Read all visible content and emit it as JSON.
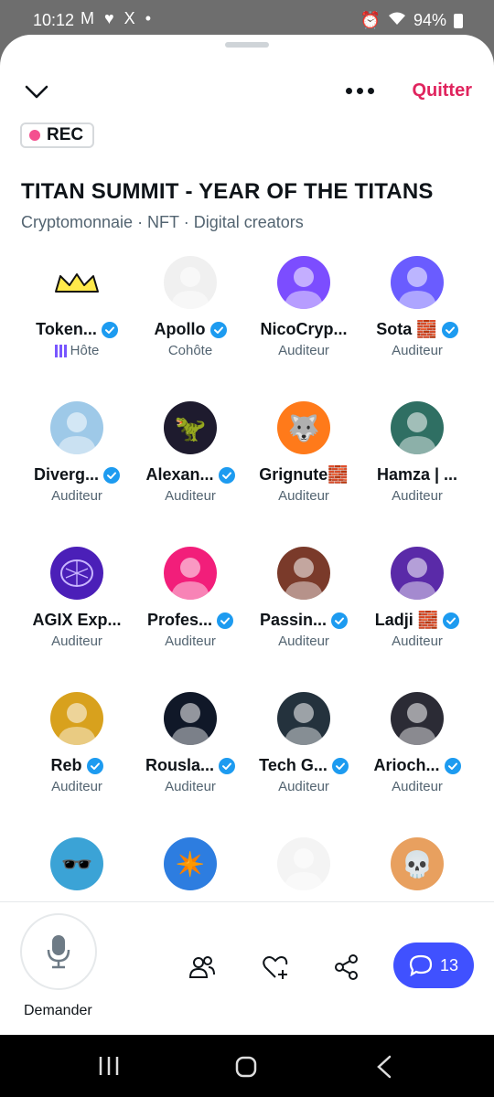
{
  "status": {
    "time": "10:12",
    "notifications": "M ♥ X •",
    "battery": "94%"
  },
  "header": {
    "quit_label": "Quitter"
  },
  "rec_label": "REC",
  "space": {
    "title": "TITAN SUMMIT - YEAR OF THE TITANS",
    "topics": "Cryptomonnaie · NFT · Digital creators"
  },
  "participants": [
    {
      "name": "Token...",
      "role": "Hôte",
      "verified": true,
      "avatar": "crown",
      "color": "#ffffff"
    },
    {
      "name": "Apollo",
      "role": "Cohôte",
      "verified": true,
      "avatar": "face",
      "color": "#f0f0f0"
    },
    {
      "name": "NicoCryp...",
      "role": "Auditeur",
      "verified": false,
      "avatar": "face",
      "color": "#7c4dff"
    },
    {
      "name": "Sota 🧱",
      "role": "Auditeur",
      "verified": true,
      "avatar": "face",
      "color": "#6a5cff"
    },
    {
      "name": "Diverg...",
      "role": "Auditeur",
      "verified": true,
      "avatar": "face",
      "color": "#9ec9e8"
    },
    {
      "name": "Alexan...",
      "role": "Auditeur",
      "verified": true,
      "avatar": "dino",
      "color": "#1e1b2e"
    },
    {
      "name": "Grignute🧱",
      "role": "Auditeur",
      "verified": false,
      "avatar": "wolf",
      "color": "#ff7a1a"
    },
    {
      "name": "Hamza | ...",
      "role": "Auditeur",
      "verified": false,
      "avatar": "face",
      "color": "#2f6f63"
    },
    {
      "name": "AGIX Exp...",
      "role": "Auditeur",
      "verified": false,
      "avatar": "brain",
      "color": "#4b1fb8"
    },
    {
      "name": "Profes...",
      "role": "Auditeur",
      "verified": true,
      "avatar": "face",
      "color": "#f21e7a"
    },
    {
      "name": "Passin...",
      "role": "Auditeur",
      "verified": true,
      "avatar": "face",
      "color": "#7a3a2a"
    },
    {
      "name": "Ladji 🧱",
      "role": "Auditeur",
      "verified": true,
      "avatar": "face",
      "color": "#5a2aa8"
    },
    {
      "name": "Reb",
      "role": "Auditeur",
      "verified": true,
      "avatar": "face",
      "color": "#d8a11d"
    },
    {
      "name": "Rousla...",
      "role": "Auditeur",
      "verified": true,
      "avatar": "face",
      "color": "#101828"
    },
    {
      "name": "Tech G...",
      "role": "Auditeur",
      "verified": true,
      "avatar": "face",
      "color": "#24323d"
    },
    {
      "name": "Arioch...",
      "role": "Auditeur",
      "verified": true,
      "avatar": "face",
      "color": "#2b2b35"
    },
    {
      "name": "",
      "role": "",
      "verified": false,
      "avatar": "pixel",
      "color": "#3ba3d6"
    },
    {
      "name": "",
      "role": "",
      "verified": false,
      "avatar": "art",
      "color": "#2d7de0"
    },
    {
      "name": "",
      "role": "",
      "verified": false,
      "avatar": "face",
      "color": "#f4f4f4"
    },
    {
      "name": "",
      "role": "",
      "verified": false,
      "avatar": "skull",
      "color": "#e8a05f"
    }
  ],
  "bottom": {
    "mic_label": "Demander",
    "chat_count": "13"
  },
  "colors": {
    "accent": "#e0245e",
    "rec_dot": "#f4508f",
    "host": "#7856ff",
    "chat": "#4051ff",
    "verified": "#1d9bf0"
  }
}
